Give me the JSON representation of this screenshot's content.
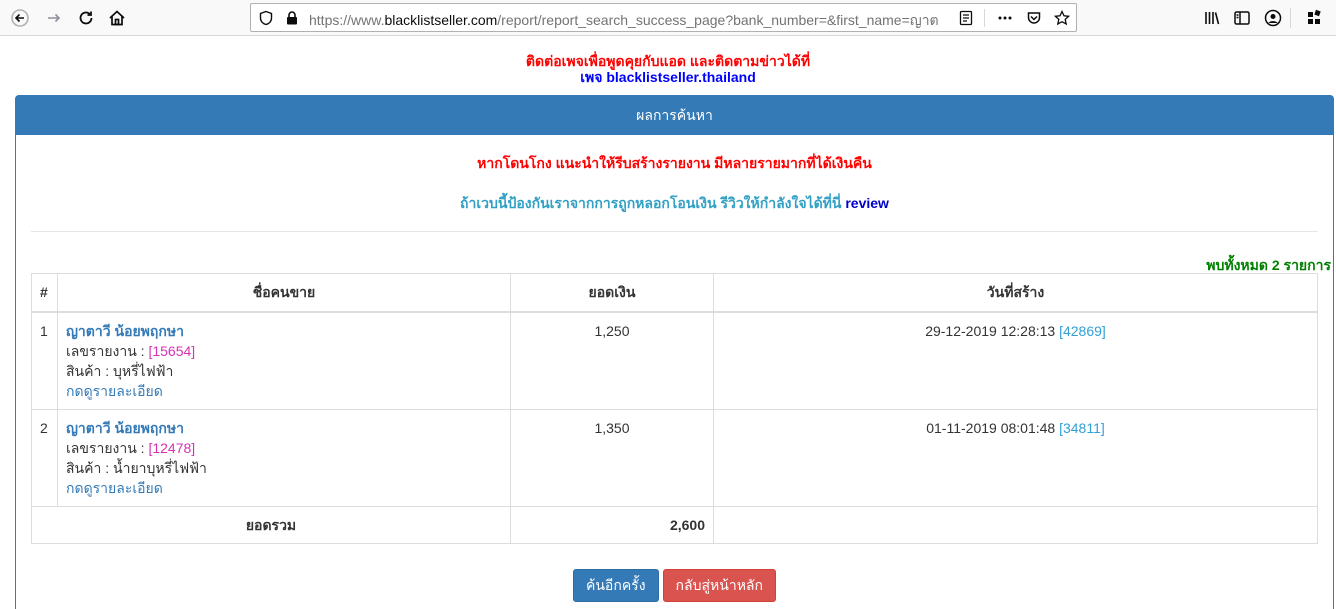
{
  "browser": {
    "url_prefix": "https://www.",
    "url_host": "blacklistseller.com",
    "url_path": "/report/report_search_success_page?bank_number=&first_name=ญาต"
  },
  "notice": {
    "line1": "ติดต่อเพจเพื่อพูดคุยกับแอด และติดตามข่าวได้ที่",
    "line2": "เพจ blacklistseller.thailand"
  },
  "panel": {
    "heading": "ผลการค้นหา",
    "warning": "หากโดนโกง แนะนำให้รีบสร้างรายงาน มีหลายรายมากที่ได้เงินคืน",
    "review_text": "ถ้าเวบนี้ป้องกันเราจากการถูกหลอกโอนเงิน รีวิวให้กำลังใจได้ที่นี่ ",
    "review_link": "review",
    "found": "พบทั้งหมด 2 รายการ"
  },
  "table": {
    "headers": [
      "#",
      "ชื่อคนขาย",
      "ยอดเงิน",
      "วันที่สร้าง"
    ],
    "rows": [
      {
        "index": "1",
        "seller": "ญาตาวี น้อยพฤกษา",
        "report_label": "เลขรายงาน : ",
        "report_id": "[15654]",
        "product_label": "สินค้า : ",
        "product": "บุหรี่ไฟฟ้า",
        "detail_link": "กดดูรายละเอียด",
        "amount": "1,250",
        "date": "29-12-2019 12:28:13 ",
        "date_id": "[42869]"
      },
      {
        "index": "2",
        "seller": "ญาตาวี น้อยพฤกษา",
        "report_label": "เลขรายงาน : ",
        "report_id": "[12478]",
        "product_label": "สินค้า : ",
        "product": "น้ำยาบุหรี่ไฟฟ้า",
        "detail_link": "กดดูรายละเอียด",
        "amount": "1,350",
        "date": "01-11-2019 08:01:48 ",
        "date_id": "[34811]"
      }
    ],
    "total_label": "ยอดรวม",
    "total_value": "2,600"
  },
  "buttons": {
    "search_again": "ค้นอีกครั้ง",
    "back_home": "กลับสู่หน้าหลัก"
  }
}
